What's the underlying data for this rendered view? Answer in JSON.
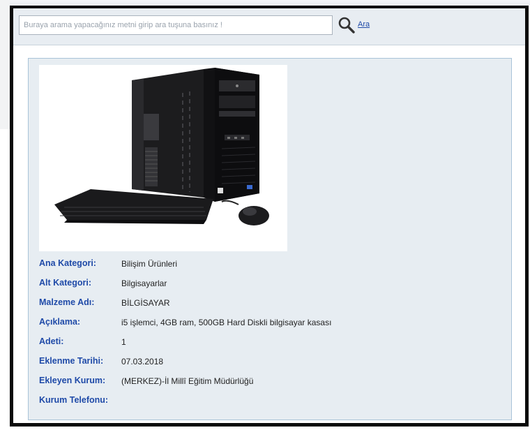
{
  "search": {
    "placeholder": "Buraya arama yapacağınız metni girip ara tuşuna basınız !",
    "value": "",
    "button_label": "Ara",
    "icon": "search-icon"
  },
  "product": {
    "image": "desktop-computer-tower-keyboard-mouse",
    "details": [
      {
        "label": "Ana Kategori:",
        "value": "Bilişim Ürünleri"
      },
      {
        "label": "Alt Kategori:",
        "value": "Bilgisayarlar"
      },
      {
        "label": "Malzeme Adı:",
        "value": "BİLGİSAYAR"
      },
      {
        "label": "Açıklama:",
        "value": "i5 işlemci, 4GB ram, 500GB Hard Diskli bilgisayar kasası"
      },
      {
        "label": "Adeti:",
        "value": "1"
      },
      {
        "label": "Eklenme Tarihi:",
        "value": "07.03.2018"
      },
      {
        "label": "Ekleyen Kurum:",
        "value": "(MERKEZ)-İl Millî Eğitim Müdürlüğü"
      },
      {
        "label": "Kurum Telefonu:",
        "value": ""
      }
    ]
  },
  "colors": {
    "label": "#1f4aa8",
    "card_bg": "#e7edf2",
    "card_border": "#a9c3d8",
    "frame": "#0a0a0a"
  }
}
